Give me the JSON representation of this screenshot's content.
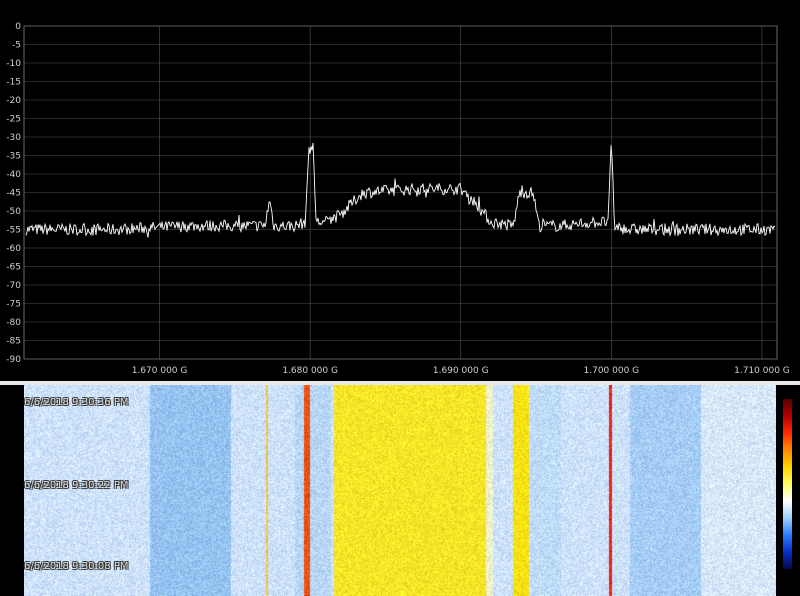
{
  "spectrum": {
    "y_axis": {
      "min": -90,
      "max": 0,
      "step": 5,
      "tick_labels": [
        "0",
        "-5",
        "-10",
        "-15",
        "-20",
        "-25",
        "-30",
        "-35",
        "-40",
        "-45",
        "-50",
        "-55",
        "-60",
        "-65",
        "-70",
        "-75",
        "-80",
        "-85",
        "-90"
      ]
    },
    "x_axis": {
      "range_ghz": [
        1.661,
        1.711
      ],
      "ticks": [
        {
          "freq_ghz": 1.67,
          "label": "1.670 000 G"
        },
        {
          "freq_ghz": 1.68,
          "label": "1.680 000 G"
        },
        {
          "freq_ghz": 1.69,
          "label": "1.690 000 G"
        },
        {
          "freq_ghz": 1.7,
          "label": "1.700 000 G"
        },
        {
          "freq_ghz": 1.71,
          "label": "1.710 000 G"
        }
      ]
    },
    "trace_color": "#ffffff",
    "grid_color": "#555555",
    "chart_data": {
      "type": "line",
      "xlabel": "",
      "ylabel": "",
      "ylim": [
        -90,
        0
      ],
      "xlim": [
        1.661,
        1.711
      ],
      "series": [
        {
          "x": [
            1.661,
            1.667,
            1.672,
            1.677,
            1.6773,
            1.6776,
            1.679,
            1.6797,
            1.6799,
            1.6802,
            1.6804,
            1.681,
            1.682,
            1.6835,
            1.687,
            1.69,
            1.6908,
            1.692,
            1.6935,
            1.6939,
            1.6948,
            1.6952,
            1.6965,
            1.699,
            1.6998,
            1.7,
            1.7002,
            1.701,
            1.706,
            1.711
          ],
          "y": [
            -55,
            -55,
            -54,
            -54,
            -47,
            -54,
            -54,
            -53,
            -33,
            -33,
            -53,
            -53,
            -51,
            -45,
            -44,
            -44,
            -47,
            -53,
            -54,
            -45,
            -45,
            -54,
            -54,
            -53,
            -53,
            -30,
            -54,
            -55,
            -55,
            -55
          ]
        }
      ]
    }
  },
  "waterfall": {
    "timestamps": [
      "6/6/2018 9:30:36 PM",
      "6/6/2018 9:30:22 PM",
      "6/6/2018 9:30:08 PM"
    ],
    "colorbar_colors": [
      "#5a0000",
      "#ff2a00",
      "#ffd200",
      "#ffffff",
      "#2a7cff",
      "#02084a"
    ]
  }
}
